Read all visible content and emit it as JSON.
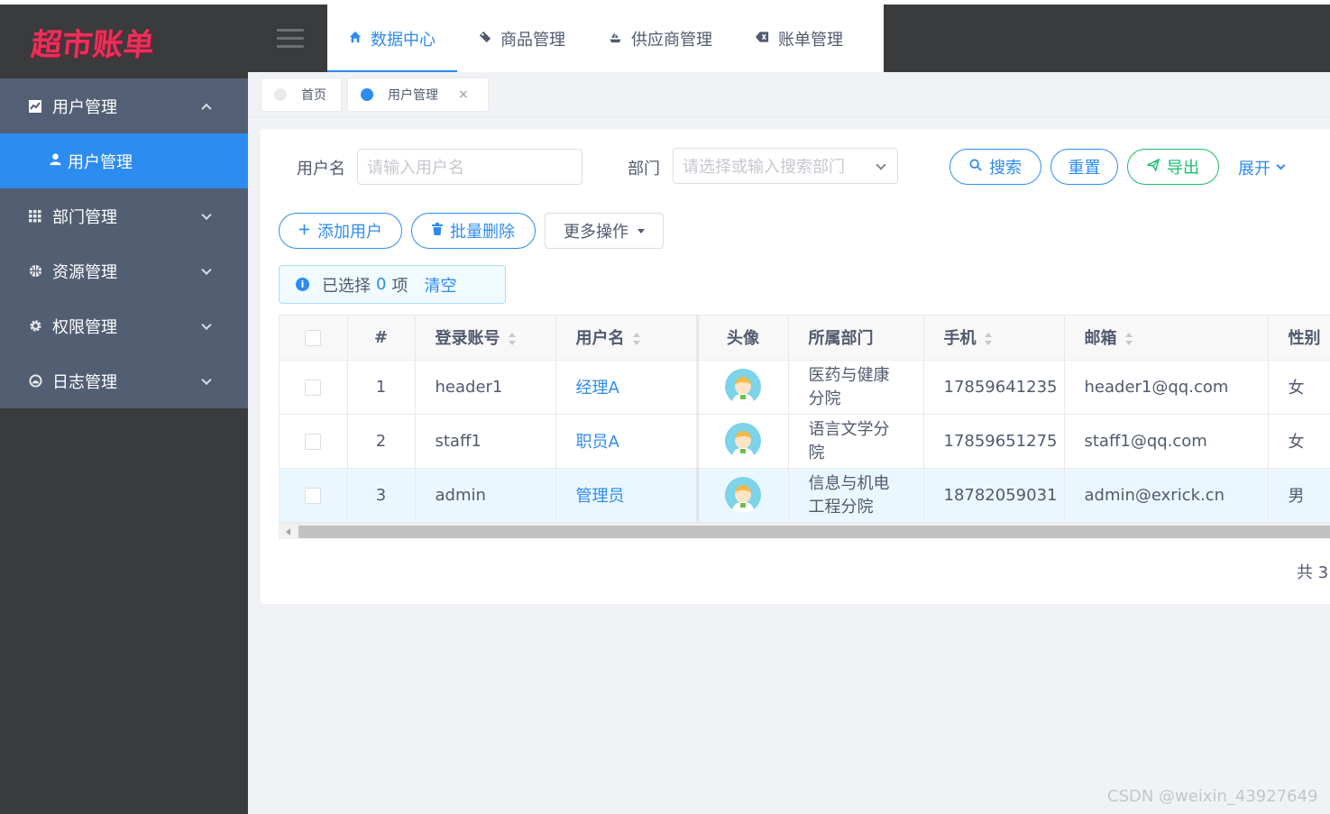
{
  "app": {
    "logo_text": "超市账单"
  },
  "sidebar": {
    "items": [
      {
        "label": "用户管理",
        "icon": "chart-icon",
        "open": true
      },
      {
        "label": "部门管理",
        "icon": "grid-icon"
      },
      {
        "label": "资源管理",
        "icon": "basketball-icon"
      },
      {
        "label": "权限管理",
        "icon": "gear-icon"
      },
      {
        "label": "日志管理",
        "icon": "gauge-icon"
      }
    ],
    "sub_active": {
      "label": "用户管理",
      "icon": "person-icon"
    }
  },
  "header": {
    "tabs": [
      {
        "label": "数据中心",
        "icon": "home-icon",
        "active": true
      },
      {
        "label": "商品管理",
        "icon": "tag-icon"
      },
      {
        "label": "供应商管理",
        "icon": "ship-icon"
      },
      {
        "label": "账单管理",
        "icon": "close-box-icon"
      }
    ]
  },
  "page_tabs": [
    {
      "label": "首页",
      "active": false
    },
    {
      "label": "用户管理",
      "active": true,
      "close": "×"
    }
  ],
  "search": {
    "username_label": "用户名",
    "username_placeholder": "请输入用户名",
    "dept_label": "部门",
    "dept_placeholder": "请选择或输入搜索部门",
    "search_btn": "搜索",
    "reset_btn": "重置",
    "export_btn": "导出",
    "expand_btn": "展开"
  },
  "actions": {
    "add_btn": "添加用户",
    "batch_delete_btn": "批量删除",
    "more_btn": "更多操作"
  },
  "selection": {
    "prefix": "已选择",
    "count": "0",
    "suffix": "项",
    "clear": "清空"
  },
  "table": {
    "columns": {
      "index": "#",
      "login": "登录账号",
      "username": "用户名",
      "avatar": "头像",
      "dept": "所属部门",
      "phone": "手机",
      "email": "邮箱",
      "gender": "性别"
    },
    "rows": [
      {
        "index": "1",
        "login": "header1",
        "username": "经理A",
        "dept_line1": "医药与健康",
        "dept_line2": "分院",
        "phone": "17859641235",
        "email": "header1@qq.com",
        "gender": "女"
      },
      {
        "index": "2",
        "login": "staff1",
        "username": "职员A",
        "dept_line1": "语言文学分",
        "dept_line2": "院",
        "phone": "17859651275",
        "email": "staff1@qq.com",
        "gender": "女"
      },
      {
        "index": "3",
        "login": "admin",
        "username": "管理员",
        "dept_line1": "信息与机电",
        "dept_line2": "工程分院",
        "phone": "18782059031",
        "email": "admin@exrick.cn",
        "gender": "男"
      }
    ]
  },
  "pagination": {
    "total_text": "共 3"
  },
  "watermark": "CSDN @weixin_43927649",
  "colors": {
    "primary": "#2d8cf0",
    "success": "#19be6b",
    "sidebar": "#3a3b3d",
    "menu": "#525f73",
    "logo": "#e8315a"
  }
}
